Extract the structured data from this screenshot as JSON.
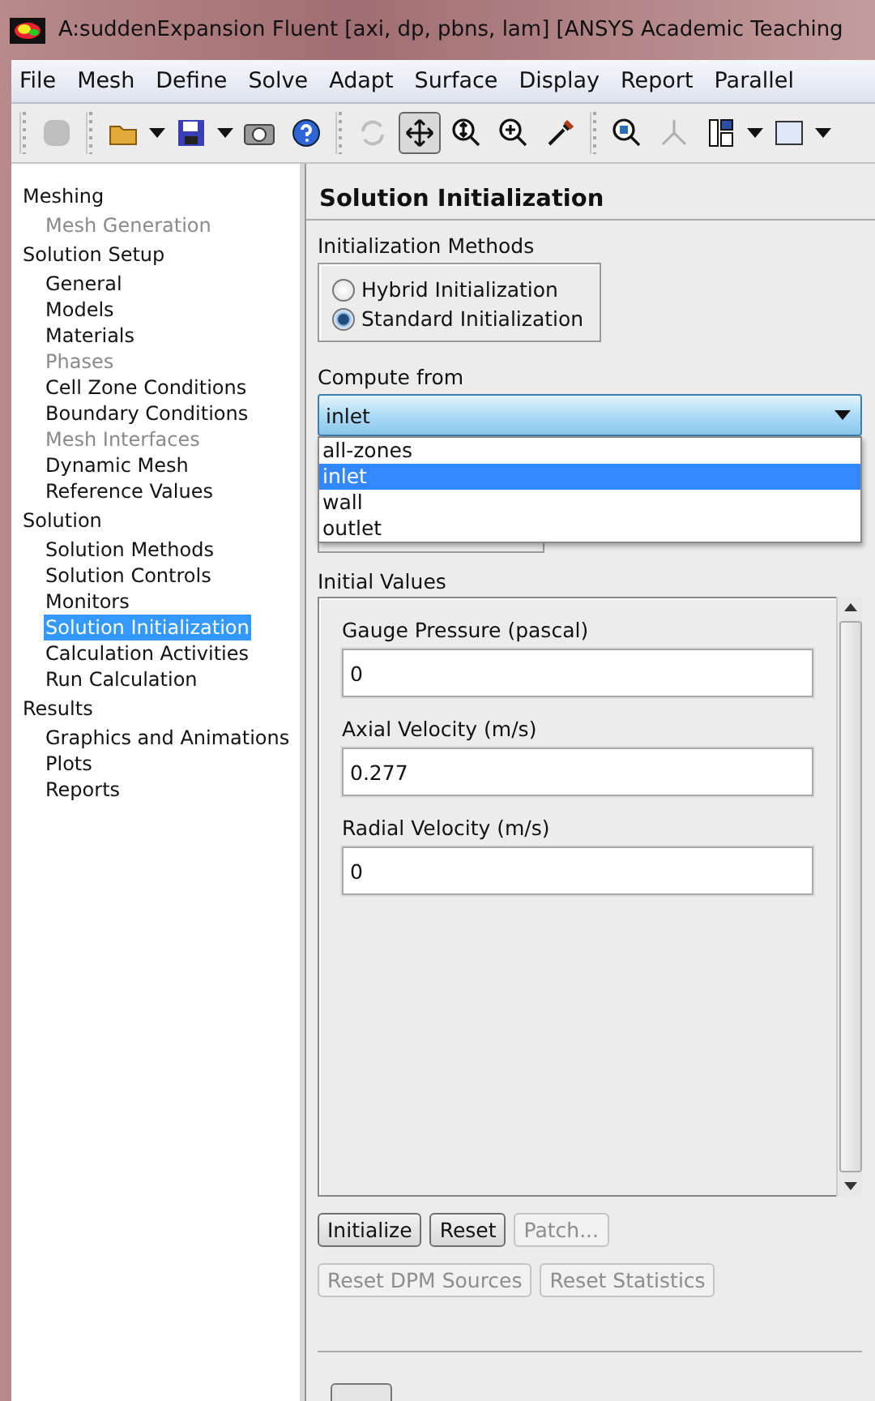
{
  "window": {
    "title": "A:suddenExpansion Fluent  [axi, dp, pbns, lam] [ANSYS Academic Teaching"
  },
  "menu": [
    "File",
    "Mesh",
    "Define",
    "Solve",
    "Adapt",
    "Surface",
    "Display",
    "Report",
    "Parallel"
  ],
  "toolbar": [
    {
      "kind": "grip"
    },
    {
      "kind": "blank",
      "disabled": true
    },
    {
      "kind": "grip"
    },
    {
      "kind": "folder"
    },
    {
      "kind": "caret"
    },
    {
      "kind": "save"
    },
    {
      "kind": "caret"
    },
    {
      "kind": "camera"
    },
    {
      "kind": "help"
    },
    {
      "kind": "grip"
    },
    {
      "kind": "rotate",
      "disabled": true
    },
    {
      "kind": "pan",
      "selected": true
    },
    {
      "kind": "zoomfit"
    },
    {
      "kind": "zoomin"
    },
    {
      "kind": "probe"
    },
    {
      "kind": "grip"
    },
    {
      "kind": "zoombox"
    },
    {
      "kind": "axes",
      "disabled": true
    },
    {
      "kind": "layout"
    },
    {
      "kind": "caret"
    },
    {
      "kind": "view"
    },
    {
      "kind": "caret"
    }
  ],
  "tree": [
    {
      "label": "Meshing",
      "children": [
        {
          "label": "Mesh Generation",
          "disabled": true,
          "selected": false
        }
      ]
    },
    {
      "label": "Solution Setup",
      "children": [
        {
          "label": "General",
          "disabled": false,
          "selected": false
        },
        {
          "label": "Models",
          "disabled": false,
          "selected": false
        },
        {
          "label": "Materials",
          "disabled": false,
          "selected": false
        },
        {
          "label": "Phases",
          "disabled": true,
          "selected": false
        },
        {
          "label": "Cell Zone Conditions",
          "disabled": false,
          "selected": false
        },
        {
          "label": "Boundary Conditions",
          "disabled": false,
          "selected": false
        },
        {
          "label": "Mesh Interfaces",
          "disabled": true,
          "selected": false
        },
        {
          "label": "Dynamic Mesh",
          "disabled": false,
          "selected": false
        },
        {
          "label": "Reference Values",
          "disabled": false,
          "selected": false
        }
      ]
    },
    {
      "label": "Solution",
      "children": [
        {
          "label": "Solution Methods",
          "disabled": false,
          "selected": false
        },
        {
          "label": "Solution Controls",
          "disabled": false,
          "selected": false
        },
        {
          "label": "Monitors",
          "disabled": false,
          "selected": false
        },
        {
          "label": "Solution Initialization",
          "disabled": false,
          "selected": true
        },
        {
          "label": "Calculation Activities",
          "disabled": false,
          "selected": false
        },
        {
          "label": "Run Calculation",
          "disabled": false,
          "selected": false
        }
      ]
    },
    {
      "label": "Results",
      "children": [
        {
          "label": "Graphics and Animations",
          "disabled": false,
          "selected": false
        },
        {
          "label": "Plots",
          "disabled": false,
          "selected": false
        },
        {
          "label": "Reports",
          "disabled": false,
          "selected": false
        }
      ]
    }
  ],
  "panel": {
    "title": "Solution Initialization",
    "methods": {
      "label": "Initialization Methods",
      "options": [
        {
          "label": "Hybrid  Initialization",
          "selected": false
        },
        {
          "label": "Standard Initialization",
          "selected": true
        }
      ]
    },
    "compute_from": {
      "label": "Compute from",
      "value": "inlet",
      "expanded": true,
      "options": [
        {
          "label": "all-zones",
          "selected": false
        },
        {
          "label": "inlet",
          "selected": true
        },
        {
          "label": "wall",
          "selected": false
        },
        {
          "label": "outlet",
          "selected": false
        }
      ]
    },
    "initial_values": {
      "label": "Initial Values",
      "fields": [
        {
          "label": "Gauge Pressure (pascal)",
          "value": "0"
        },
        {
          "label": "Axial Velocity (m/s)",
          "value": "0.277"
        },
        {
          "label": "Radial Velocity (m/s)",
          "value": "0"
        }
      ]
    },
    "buttons": [
      [
        {
          "label": "Initialize",
          "disabled": false
        },
        {
          "label": "Reset",
          "disabled": false
        },
        {
          "label": "Patch...",
          "disabled": true
        }
      ],
      [
        {
          "label": "Reset DPM Sources",
          "disabled": true
        },
        {
          "label": "Reset Statistics",
          "disabled": true
        }
      ]
    ]
  }
}
